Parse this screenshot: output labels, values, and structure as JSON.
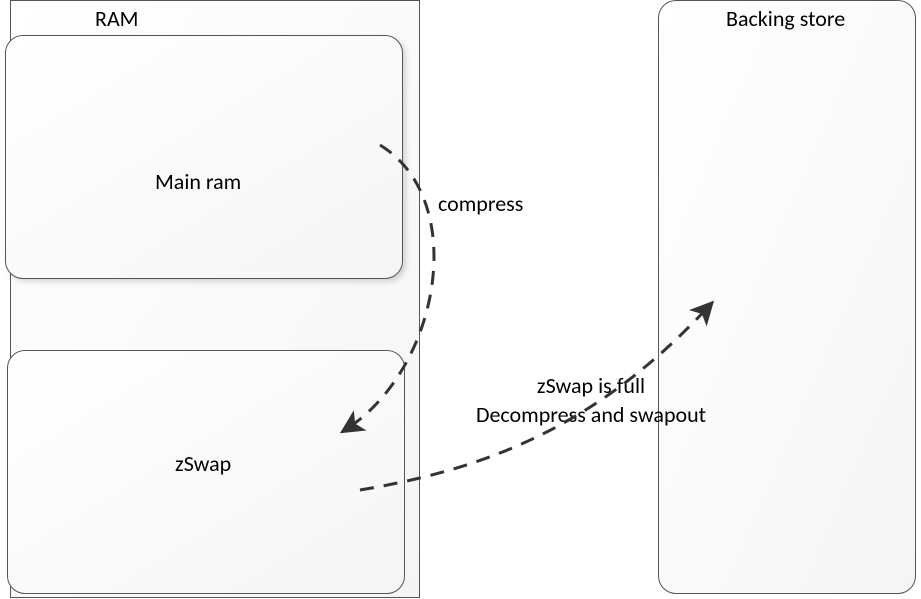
{
  "diagram": {
    "ram_container_label": "RAM",
    "main_ram_label": "Main ram",
    "zswap_label": "zSwap",
    "backing_store_label": "Backing store",
    "arrow1_label": "compress",
    "arrow2_line1": "zSwap is full",
    "arrow2_line2": "Decompress and swapout"
  }
}
